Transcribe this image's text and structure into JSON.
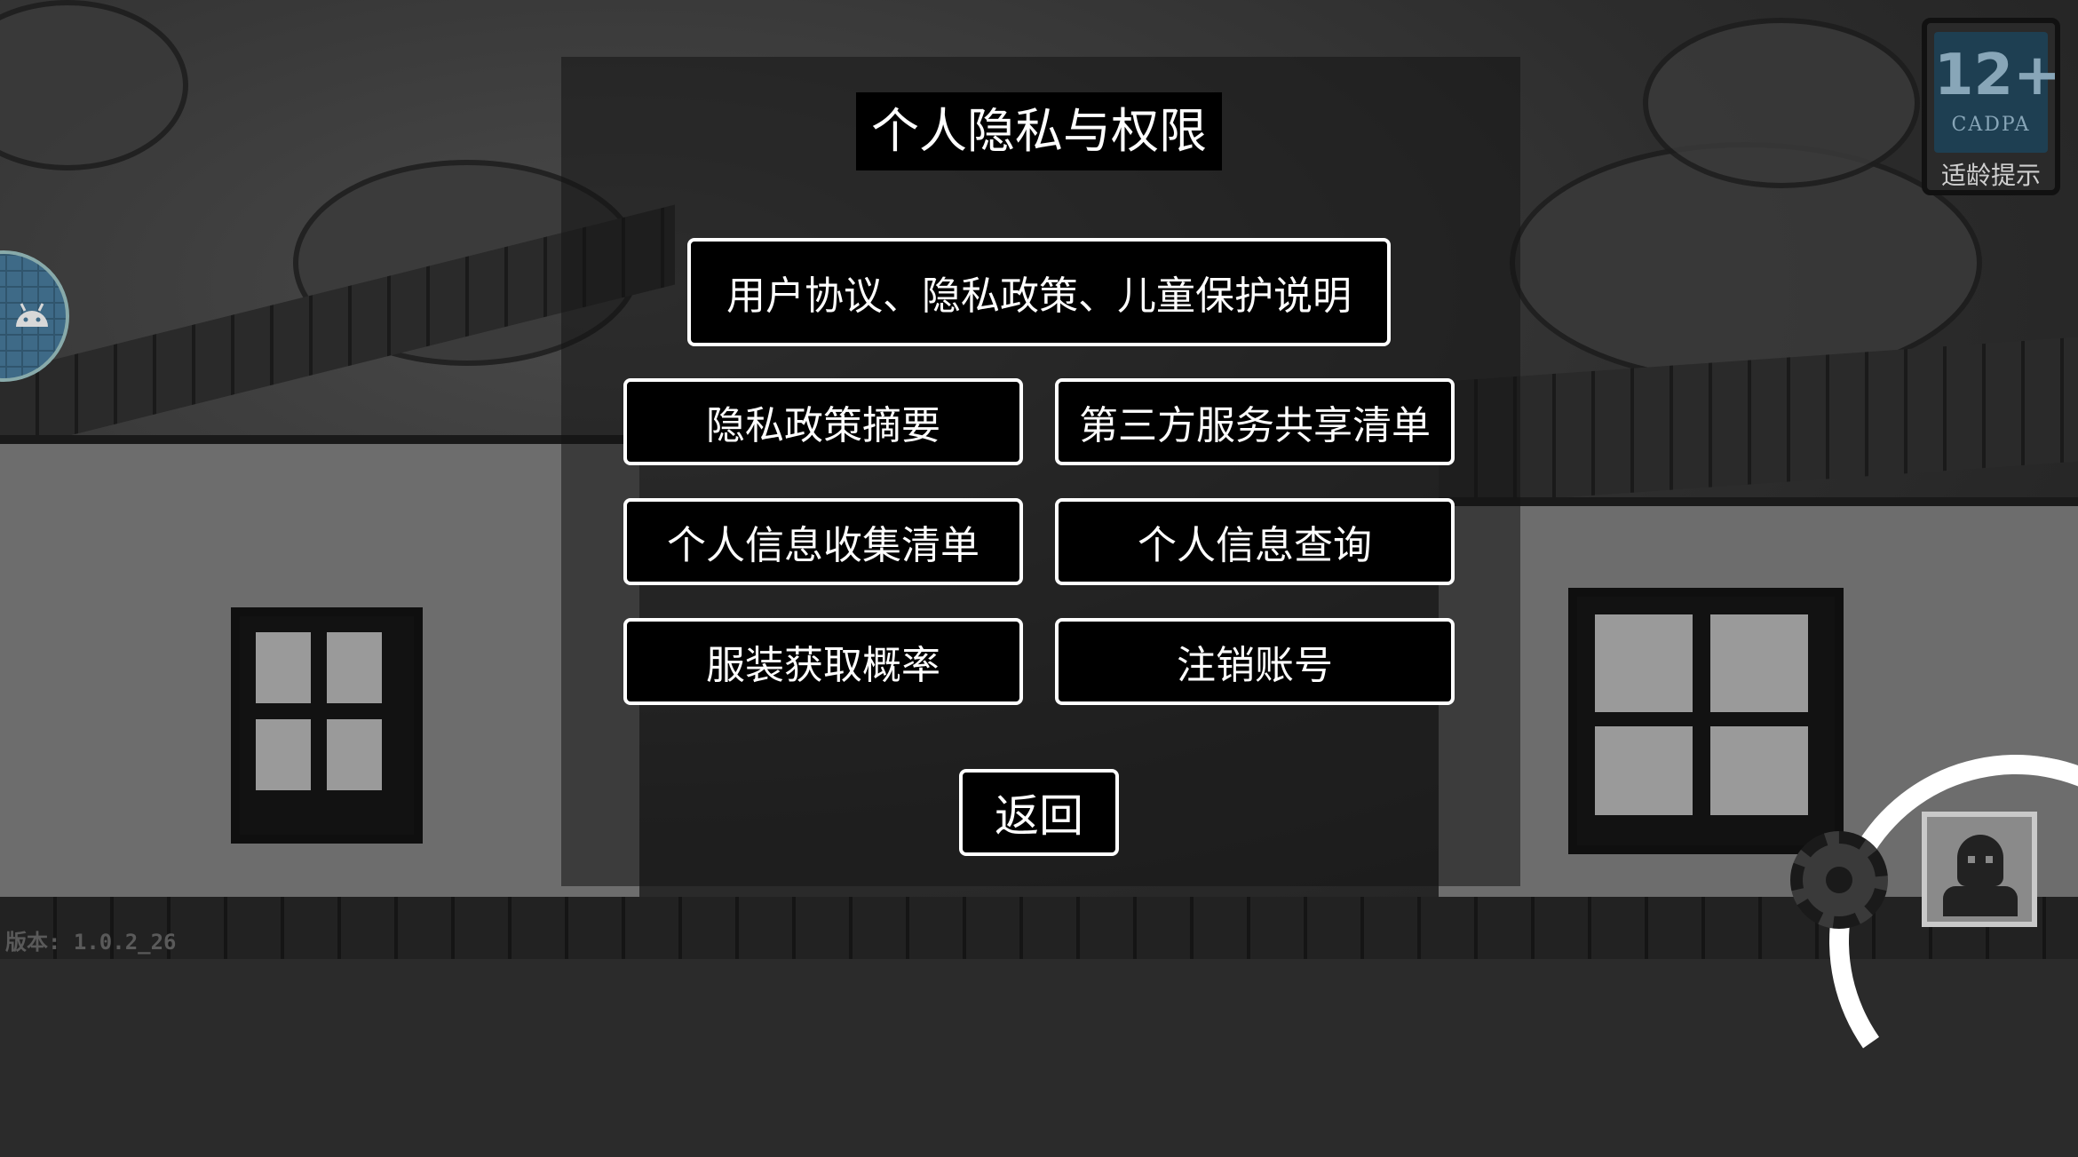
{
  "dialog": {
    "title": "个人隐私与权限",
    "buttons": {
      "agreement": "用户协议、隐私政策、儿童保护说明",
      "privacy_summary": "隐私政策摘要",
      "third_party": "第三方服务共享清单",
      "info_collection": "个人信息收集清单",
      "info_query": "个人信息查询",
      "costume_probability": "服装获取概率",
      "delete_account": "注销账号",
      "back": "返回"
    }
  },
  "rating_badge": {
    "age": "12+",
    "org": "CADPA",
    "label": "适龄提示"
  },
  "version_text": "版本: 1.0.2_26",
  "icons": {
    "floating": "android-icon",
    "settings": "gear-icon",
    "profile": "avatar-icon"
  }
}
